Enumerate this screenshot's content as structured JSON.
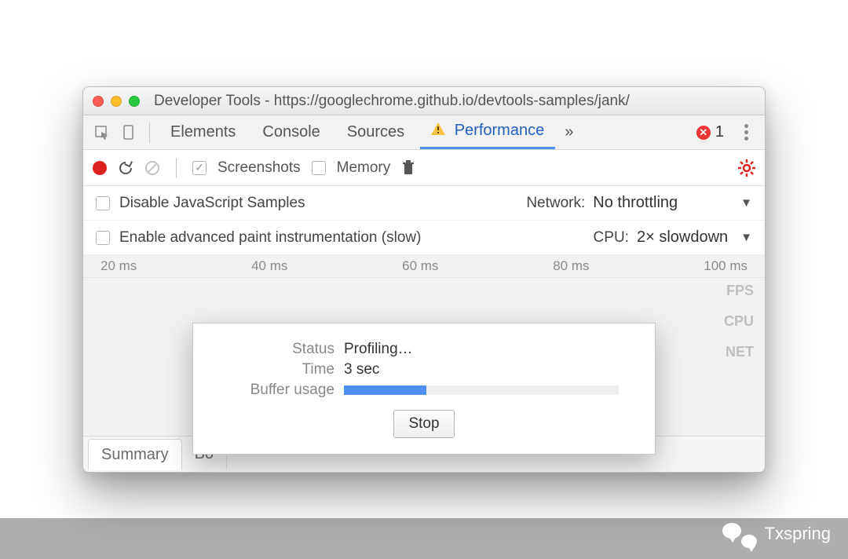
{
  "window": {
    "title": "Developer Tools - https://googlechrome.github.io/devtools-samples/jank/"
  },
  "tabs": {
    "elements": "Elements",
    "console": "Console",
    "sources": "Sources",
    "performance": "Performance",
    "overflow": "»",
    "error_count": "1"
  },
  "toolbar": {
    "screenshots_label": "Screenshots",
    "memory_label": "Memory"
  },
  "options": {
    "disable_js_samples": "Disable JavaScript Samples",
    "enable_paint_instr": "Enable advanced paint instrumentation (slow)",
    "network_label": "Network:",
    "network_value": "No throttling",
    "cpu_label": "CPU:",
    "cpu_value": "2× slowdown"
  },
  "timeline": {
    "ticks": [
      "20 ms",
      "40 ms",
      "60 ms",
      "80 ms",
      "100 ms"
    ],
    "rows": [
      "FPS",
      "CPU",
      "NET"
    ]
  },
  "modal": {
    "status_label": "Status",
    "status_value": "Profiling…",
    "time_label": "Time",
    "time_value": "3 sec",
    "buffer_label": "Buffer usage",
    "buffer_percent": 30,
    "stop": "Stop"
  },
  "bottom_tabs": {
    "summary": "Summary",
    "truncated": "Bo"
  },
  "watermark": "Txspring"
}
